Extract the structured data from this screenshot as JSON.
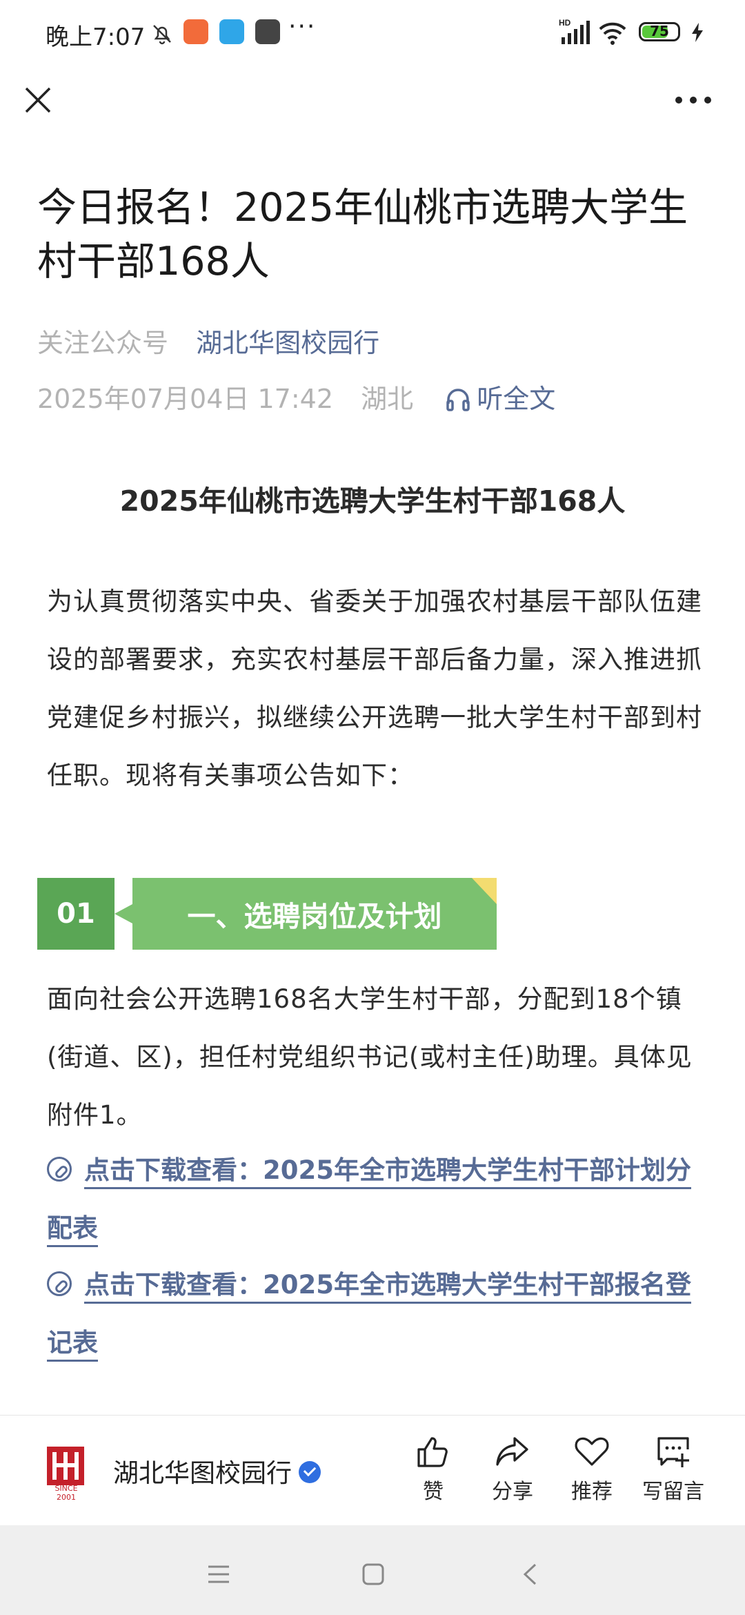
{
  "status_bar": {
    "time": "晚上7:07",
    "more": "···",
    "battery": "75",
    "battery_level": 0.75,
    "icons": [
      "mute-bell-icon",
      "app-notification-icon",
      "wallet-notification-icon",
      "mi-notification-icon",
      "hd-signal-icon",
      "wifi-icon",
      "charging-icon"
    ]
  },
  "header": {
    "close_icon": "close-icon",
    "more_icon": "more-horizontal-icon"
  },
  "article": {
    "title": "今日报名！2025年仙桃市选聘大学生村干部168人",
    "follow_label": "关注公众号",
    "account_name": "湖北华图校园行",
    "date": "2025年07月04日 17:42",
    "location": "湖北",
    "listen_label": "听全文",
    "heading": "2025年仙桃市选聘大学生村干部168人",
    "intro": "为认真贯彻落实中央、省委关于加强农村基层干部队伍建设的部署要求，充实农村基层干部后备力量，深入推进抓党建促乡村振兴，拟继续公开选聘一批大学生村干部到村任职。现将有关事项公告如下：",
    "section": {
      "number": "01",
      "title": "一、选聘岗位及计划"
    },
    "section_text": "面向社会公开选聘168名大学生村干部，分配到18个镇(街道、区)，担任村党组织书记(或村主任)助理。具体见附件1。",
    "links": [
      "点击下载查看：2025年全市选聘大学生村干部计划分配表",
      "点击下载查看：2025年全市选聘大学生村干部报名登记表"
    ]
  },
  "bottom_bar": {
    "account_name": "湖北华图校园行",
    "logo_text": "SINCE 2001",
    "actions": {
      "like": "赞",
      "share": "分享",
      "recommend": "推荐",
      "comment": "写留言"
    }
  },
  "colors": {
    "link": "#576b95",
    "section_dark": "#5aa655",
    "section_light": "#7bc16f",
    "accent_corner": "#f3dc70",
    "logo_red": "#c4202a"
  }
}
